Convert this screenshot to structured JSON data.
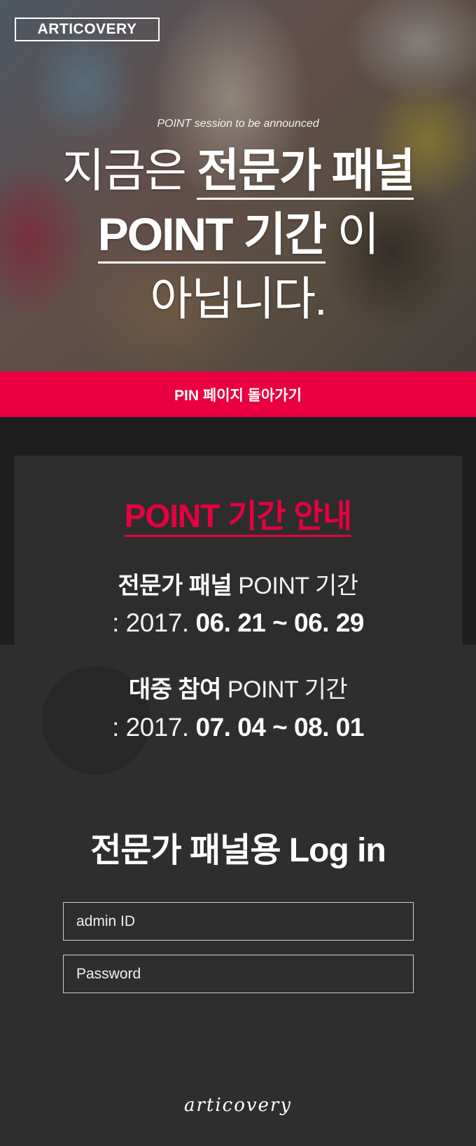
{
  "header": {
    "logo": "ARTICOVERY"
  },
  "hero": {
    "subtitle": "POINT session to be announced",
    "line1_plain": "지금은",
    "line1_bold": "전문가 패널",
    "line2_bold": "POINT 기간",
    "line2_plain": "이",
    "line3": "아닙니다."
  },
  "pin_button": {
    "label": "PIN 페이지 돌아가기"
  },
  "point_info": {
    "title": "POINT 기간 안내",
    "expert": {
      "label_bold": "전문가 패널",
      "label_light": "POINT 기간",
      "date_prefix": ": 2017.",
      "date_range": "06. 21 ~ 06. 29"
    },
    "public": {
      "label_bold": "대중 참여",
      "label_light": "POINT 기간",
      "date_prefix": ": 2017.",
      "date_range": "07. 04 ~ 08. 01"
    }
  },
  "login": {
    "title": "전문가 패널용 Log in",
    "id_placeholder": "admin ID",
    "password_placeholder": "Password"
  },
  "footer": {
    "logo": "articovery"
  },
  "colors": {
    "accent": "#ea0040",
    "background": "#2e2e2e"
  }
}
